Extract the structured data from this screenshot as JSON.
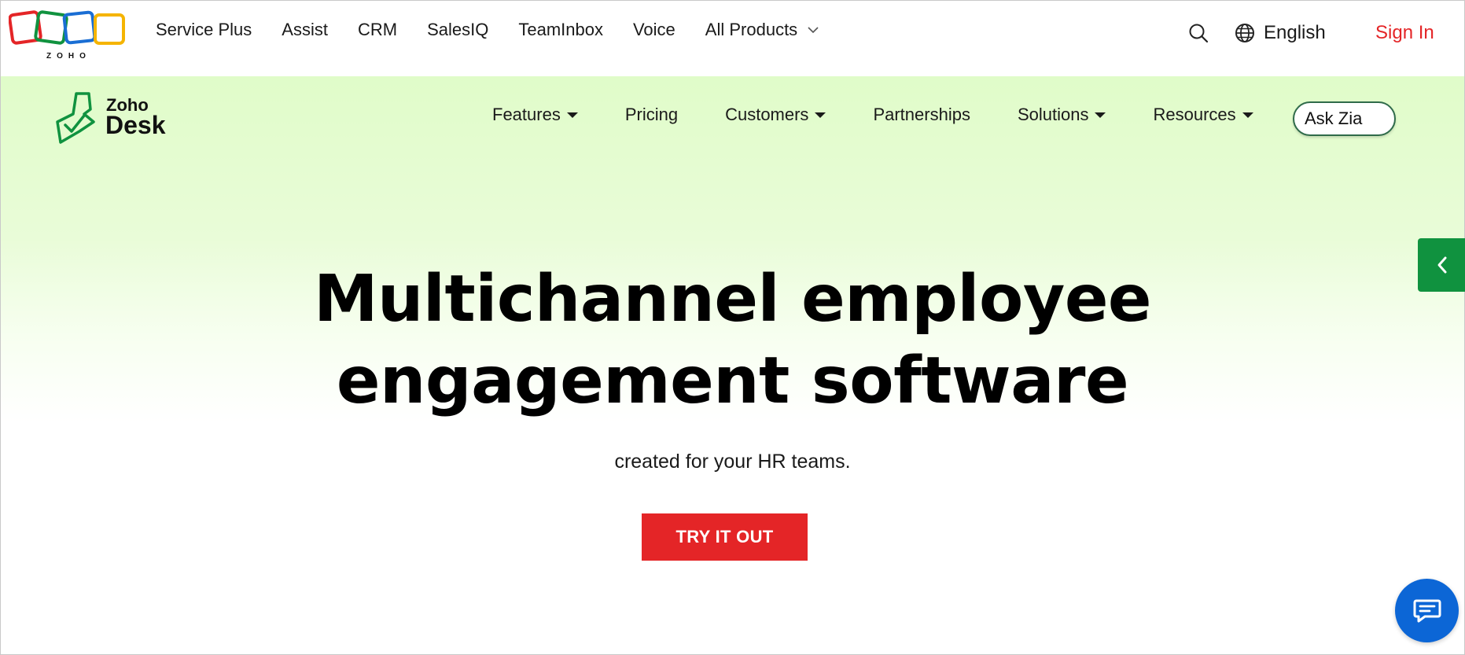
{
  "topbar": {
    "logo_text": "ZOHO",
    "nav": [
      "Service Plus",
      "Assist",
      "CRM",
      "SalesIQ",
      "TeamInbox",
      "Voice",
      "All Products"
    ],
    "language": "English",
    "sign_in": "Sign In"
  },
  "product": {
    "brand_top": "Zoho",
    "brand_main": "Desk"
  },
  "main_nav": {
    "items": [
      {
        "label": "Features",
        "has_dropdown": true
      },
      {
        "label": "Pricing",
        "has_dropdown": false
      },
      {
        "label": "Customers",
        "has_dropdown": true
      },
      {
        "label": "Partnerships",
        "has_dropdown": false
      },
      {
        "label": "Solutions",
        "has_dropdown": true
      },
      {
        "label": "Resources",
        "has_dropdown": true
      }
    ],
    "ask_zia": "Ask Zia"
  },
  "hero": {
    "headline_line1": "Multichannel employee",
    "headline_line2": "engagement software",
    "subline": "created for your HR teams.",
    "cta": "TRY IT OUT"
  },
  "icons": {
    "search": "search-icon",
    "globe": "globe-icon",
    "side_tab": "chevron-left-icon",
    "chat": "chat-icon",
    "all_products": "chevron-down-icon"
  },
  "colors": {
    "brand_red": "#e42527",
    "desk_green": "#10923f",
    "chat_blue": "#0c66d6",
    "hero_tint": "#e0fcc9"
  }
}
